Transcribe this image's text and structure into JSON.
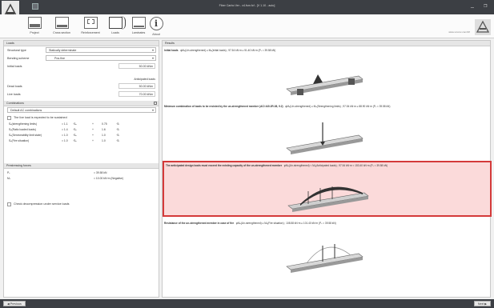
{
  "window": {
    "title": "Fiber Carbo Ver - x4.fsm.fcf - [V 1.10 - auto]",
    "minimize": "_",
    "restore": "❐"
  },
  "toolbar": {
    "items": [
      {
        "label": "Project"
      },
      {
        "label": "Cross section"
      },
      {
        "label": "Reinforcement"
      },
      {
        "label": "Loads"
      },
      {
        "label": "Laminates"
      },
      {
        "label": "About"
      }
    ],
    "brand": "www.xxxxxx.com/fcf"
  },
  "left": {
    "loads_header": "Loads",
    "structural_type_label": "Structural type",
    "structural_type_value": "Statically determinate",
    "bending_scheme_label": "Bending scheme",
    "bending_scheme_value": "Pos.fine",
    "initial_loads_label": "Initial loads",
    "initial_loads_value": "50.00 kNm",
    "anticipated_label": "Anticipated loads",
    "dead_loads_label": "Dead loads",
    "dead_loads_value": "50.00 kNm",
    "live_loads_label": "Live loads",
    "live_loads_value": "70.00 kNm",
    "combinations_header": "Combinations",
    "combinations_value": "Default AC combinations",
    "sustained_label": "The live load is expected to be sustained",
    "combos": [
      {
        "name": "Sₑ(strengthening limits)",
        "a": "= 1.1",
        "b": "·Sₑ",
        "c": "+",
        "d": "0.75",
        "e": "·Sₗ"
      },
      {
        "name": "Sₑ(Ratio loaded loads)",
        "a": "= 1.4",
        "b": "·Sₑ",
        "c": "+",
        "d": "1.6",
        "e": "·Sₗ"
      },
      {
        "name": "Sₑ(Serviceability limit state)",
        "a": "= 1.0",
        "b": "·Sₑ",
        "c": "+",
        "d": "1.0",
        "e": "·Sₗ"
      },
      {
        "name": "Sₑ(Fire situation)",
        "a": "= 1.0",
        "b": "·Sₑ",
        "c": "+",
        "d": "1.0",
        "e": "·Sₗ"
      }
    ],
    "prestress_header": "Prestressing forces",
    "prestress": [
      {
        "name": "Pₓ",
        "value": "= 39.58 kN"
      },
      {
        "name": "Mₓ",
        "value": "= 10.00 kN·m (Negative)"
      }
    ],
    "decompression_label": "Check decompression under service loads"
  },
  "results": {
    "header": "Results",
    "cards": [
      {
        "title": "Initial loads",
        "text": "φMₙ(Un-strengthened) ≥ Mₙ(Initial loads) ; 97.54 kN·m ≥ 51.40 kN·m (Pₓ = 39.58 kN)"
      },
      {
        "title": "Minimum combination of loads to be resisted by the un-strengthened member (ACI 440.2R-08, 9.2)",
        "text": "φMₙ(Un-strengthened) ≥ Mₙ(Strengthening limits) ; 97.54 kN·m ≥ 88.90 kN·m (Pₓ = 39.58 kN)"
      },
      {
        "title": "The anticipated design loads must exceed the existing capacity of the un-strengthened member",
        "text": "φMₙ(Un-strengthened) < Mₙ(Anticipated loads) ; 97.54 kN·m < 153.40 kN·m (Pₓ = 39.58 kN)"
      },
      {
        "title": "Resistance of the un-strengthened member in case of fire",
        "text": "φMₙ(Un-strengthened) ≥ Mₙ(Fire situation) ; 108.58 kN·m ≥ 101.40 kN·m (Pₓ = 39.58 kN)"
      }
    ]
  },
  "footer": {
    "previous": "Previous",
    "next": "Next"
  },
  "colors": {
    "accent": "#d43a3a",
    "highlight_bg": "#fbdada",
    "titlebar": "#3c3f44"
  }
}
